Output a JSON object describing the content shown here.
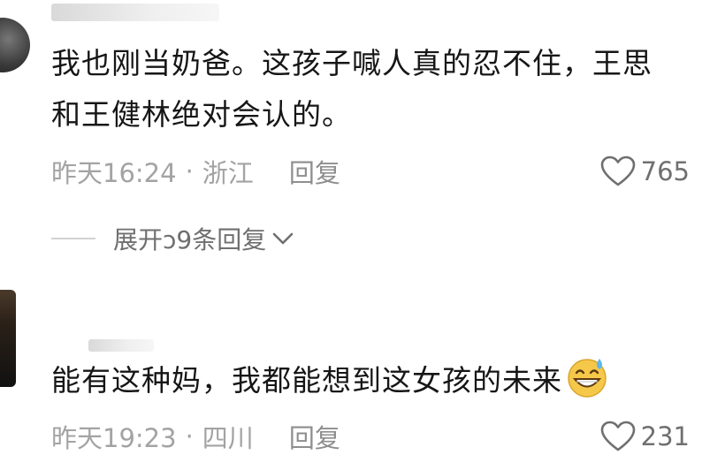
{
  "comments": [
    {
      "text_line1": "我也刚当奶爸。这孩子喊人真的忍不住，王思",
      "text_line2": "和王健林绝对会认的。",
      "time": "昨天16:24",
      "separator": "·",
      "location": "浙江",
      "reply_label": "回复",
      "likes": "765",
      "like_icon": "heart-outline-icon"
    },
    {
      "text": "能有这种妈，我都能想到这女孩的未来",
      "emoji": "grinning-sweat-emoji",
      "time": "昨天19:23",
      "separator": "·",
      "location": "四川",
      "reply_label": "回复",
      "likes": "231",
      "like_icon": "heart-outline-icon"
    }
  ],
  "expand_replies": {
    "label": "展开",
    "label_partial": "ͻ9条回复",
    "chevron_icon": "chevron-down-icon"
  },
  "colors": {
    "text": "#161616",
    "meta": "#a3a3a3",
    "reply": "#8e8e8e",
    "likes": "#707070",
    "emoji_face": "#f6c84a"
  }
}
